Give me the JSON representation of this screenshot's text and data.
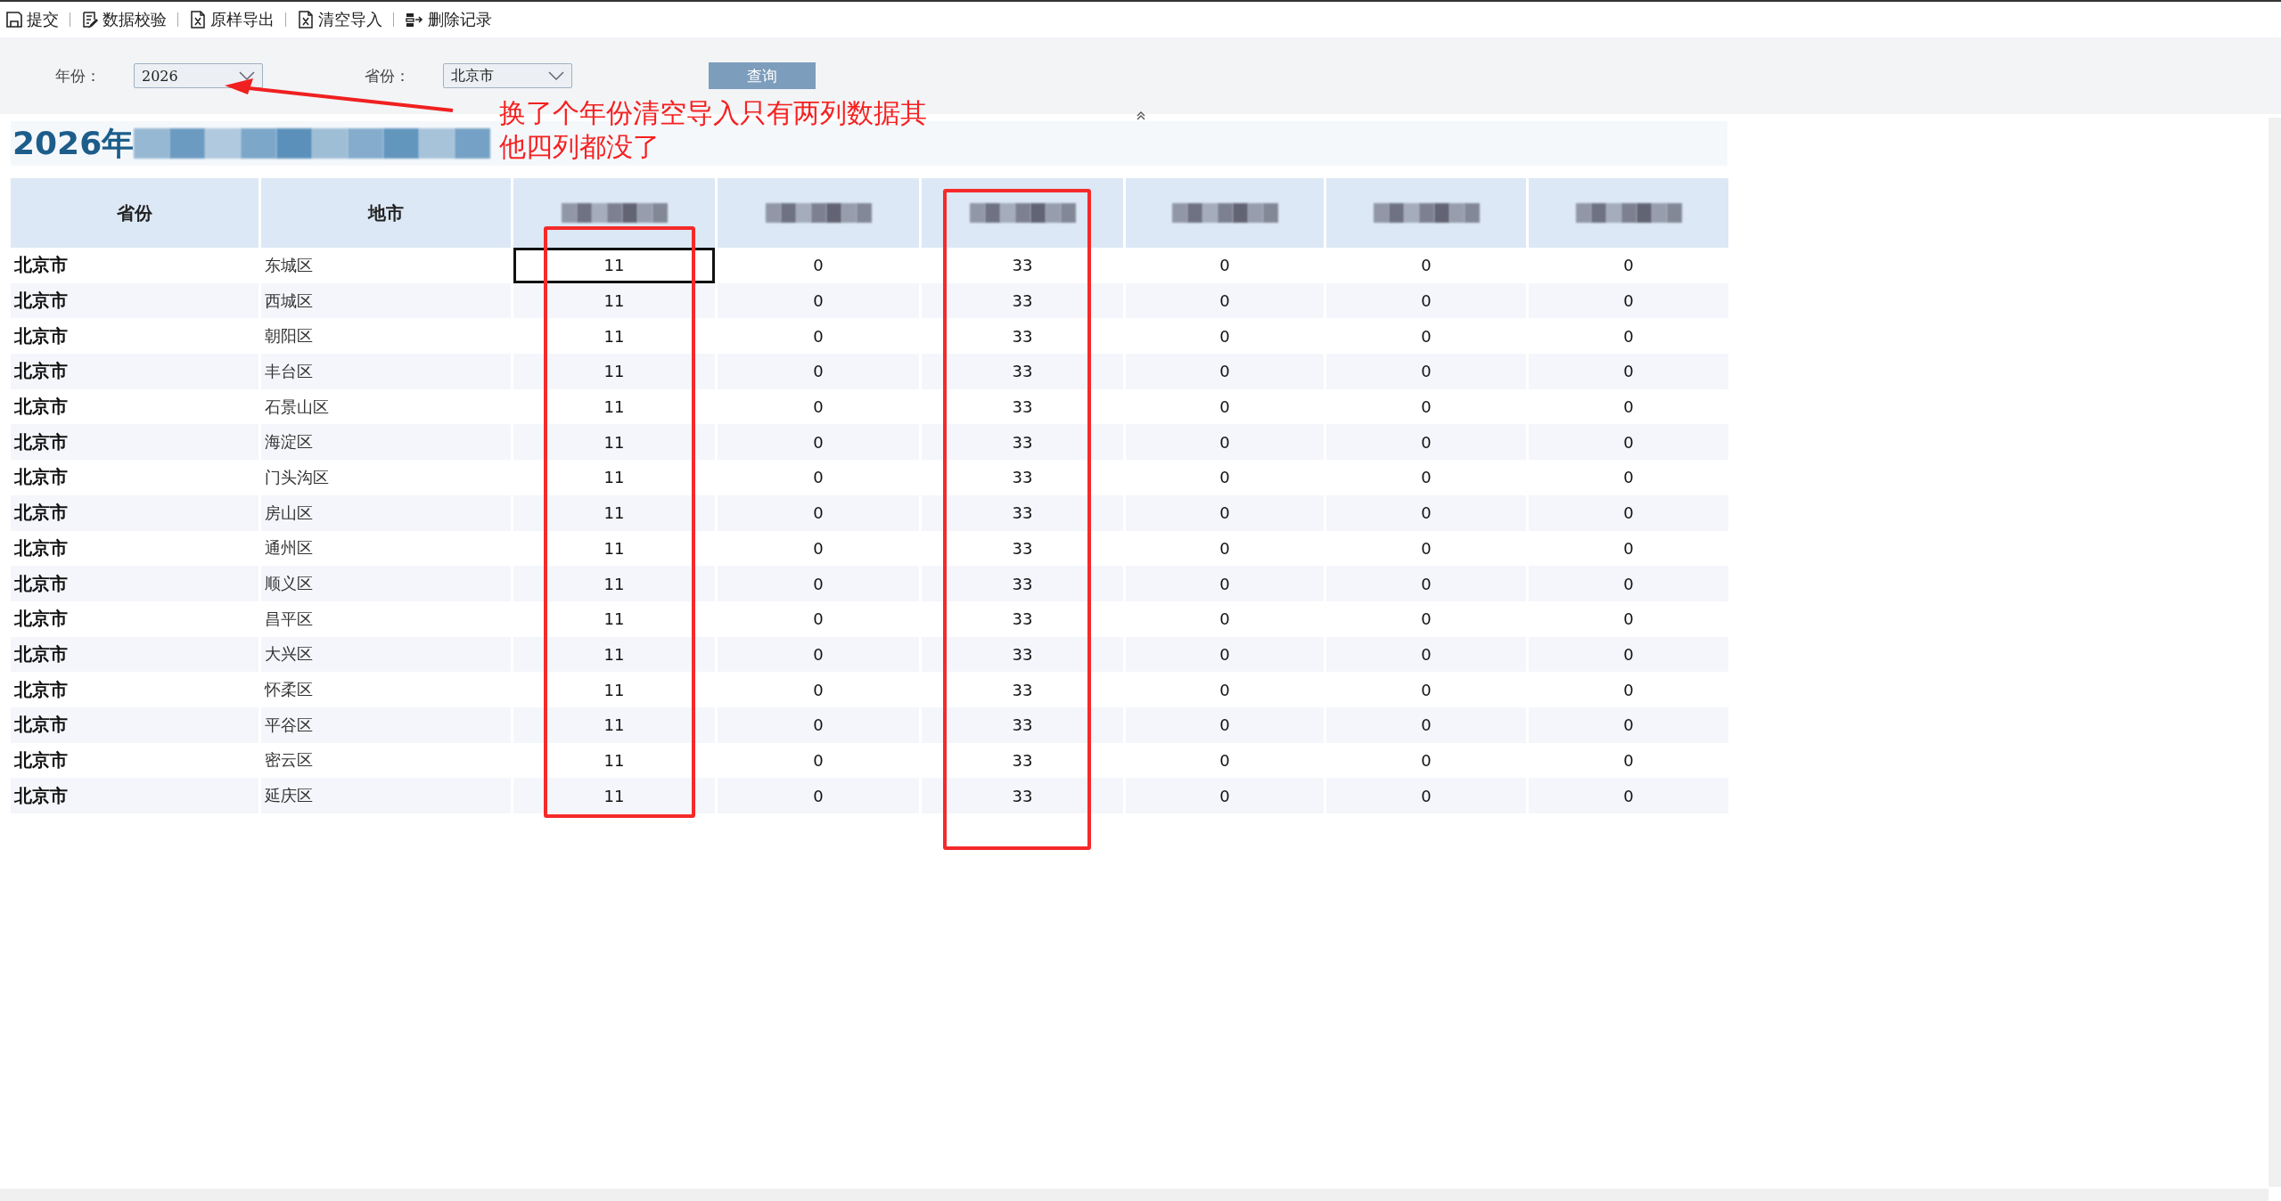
{
  "toolbar": [
    {
      "label": "提交",
      "kind": "save"
    },
    {
      "label": "数据校验",
      "kind": "check"
    },
    {
      "label": "原样导出",
      "kind": "excel"
    },
    {
      "label": "清空导入",
      "kind": "excel"
    },
    {
      "label": "删除记录",
      "kind": "delete"
    }
  ],
  "filters": [
    {
      "label": "年份：",
      "value": "2026"
    },
    {
      "label": "省份：",
      "value": "北京市"
    }
  ],
  "query_button": "查询",
  "report_title": {
    "text": "2026年",
    "redacted": true
  },
  "table": {
    "columns": [
      {
        "label": "省份"
      },
      {
        "label": "地市"
      },
      {
        "kind": "redacted"
      },
      {
        "kind": "redacted"
      },
      {
        "kind": "redacted"
      },
      {
        "kind": "redacted"
      },
      {
        "kind": "redacted"
      },
      {
        "kind": "redacted"
      }
    ],
    "rows": [
      {
        "province": "北京市",
        "city": "东城区",
        "values": [
          {
            "text": "11",
            "selected": true
          },
          {
            "text": "0",
            "selected": false
          },
          {
            "text": "33",
            "selected": false
          },
          {
            "text": "0",
            "selected": false
          },
          {
            "text": "0",
            "selected": false
          },
          {
            "text": "0",
            "selected": false
          }
        ]
      },
      {
        "province": "北京市",
        "city": "西城区",
        "values": [
          {
            "text": "11",
            "selected": false
          },
          {
            "text": "0",
            "selected": false
          },
          {
            "text": "33",
            "selected": false
          },
          {
            "text": "0",
            "selected": false
          },
          {
            "text": "0",
            "selected": false
          },
          {
            "text": "0",
            "selected": false
          }
        ]
      },
      {
        "province": "北京市",
        "city": "朝阳区",
        "values": [
          {
            "text": "11",
            "selected": false
          },
          {
            "text": "0",
            "selected": false
          },
          {
            "text": "33",
            "selected": false
          },
          {
            "text": "0",
            "selected": false
          },
          {
            "text": "0",
            "selected": false
          },
          {
            "text": "0",
            "selected": false
          }
        ]
      },
      {
        "province": "北京市",
        "city": "丰台区",
        "values": [
          {
            "text": "11",
            "selected": false
          },
          {
            "text": "0",
            "selected": false
          },
          {
            "text": "33",
            "selected": false
          },
          {
            "text": "0",
            "selected": false
          },
          {
            "text": "0",
            "selected": false
          },
          {
            "text": "0",
            "selected": false
          }
        ]
      },
      {
        "province": "北京市",
        "city": "石景山区",
        "values": [
          {
            "text": "11",
            "selected": false
          },
          {
            "text": "0",
            "selected": false
          },
          {
            "text": "33",
            "selected": false
          },
          {
            "text": "0",
            "selected": false
          },
          {
            "text": "0",
            "selected": false
          },
          {
            "text": "0",
            "selected": false
          }
        ]
      },
      {
        "province": "北京市",
        "city": "海淀区",
        "values": [
          {
            "text": "11",
            "selected": false
          },
          {
            "text": "0",
            "selected": false
          },
          {
            "text": "33",
            "selected": false
          },
          {
            "text": "0",
            "selected": false
          },
          {
            "text": "0",
            "selected": false
          },
          {
            "text": "0",
            "selected": false
          }
        ]
      },
      {
        "province": "北京市",
        "city": "门头沟区",
        "values": [
          {
            "text": "11",
            "selected": false
          },
          {
            "text": "0",
            "selected": false
          },
          {
            "text": "33",
            "selected": false
          },
          {
            "text": "0",
            "selected": false
          },
          {
            "text": "0",
            "selected": false
          },
          {
            "text": "0",
            "selected": false
          }
        ]
      },
      {
        "province": "北京市",
        "city": "房山区",
        "values": [
          {
            "text": "11",
            "selected": false
          },
          {
            "text": "0",
            "selected": false
          },
          {
            "text": "33",
            "selected": false
          },
          {
            "text": "0",
            "selected": false
          },
          {
            "text": "0",
            "selected": false
          },
          {
            "text": "0",
            "selected": false
          }
        ]
      },
      {
        "province": "北京市",
        "city": "通州区",
        "values": [
          {
            "text": "11",
            "selected": false
          },
          {
            "text": "0",
            "selected": false
          },
          {
            "text": "33",
            "selected": false
          },
          {
            "text": "0",
            "selected": false
          },
          {
            "text": "0",
            "selected": false
          },
          {
            "text": "0",
            "selected": false
          }
        ]
      },
      {
        "province": "北京市",
        "city": "顺义区",
        "values": [
          {
            "text": "11",
            "selected": false
          },
          {
            "text": "0",
            "selected": false
          },
          {
            "text": "33",
            "selected": false
          },
          {
            "text": "0",
            "selected": false
          },
          {
            "text": "0",
            "selected": false
          },
          {
            "text": "0",
            "selected": false
          }
        ]
      },
      {
        "province": "北京市",
        "city": "昌平区",
        "values": [
          {
            "text": "11",
            "selected": false
          },
          {
            "text": "0",
            "selected": false
          },
          {
            "text": "33",
            "selected": false
          },
          {
            "text": "0",
            "selected": false
          },
          {
            "text": "0",
            "selected": false
          },
          {
            "text": "0",
            "selected": false
          }
        ]
      },
      {
        "province": "北京市",
        "city": "大兴区",
        "values": [
          {
            "text": "11",
            "selected": false
          },
          {
            "text": "0",
            "selected": false
          },
          {
            "text": "33",
            "selected": false
          },
          {
            "text": "0",
            "selected": false
          },
          {
            "text": "0",
            "selected": false
          },
          {
            "text": "0",
            "selected": false
          }
        ]
      },
      {
        "province": "北京市",
        "city": "怀柔区",
        "values": [
          {
            "text": "11",
            "selected": false
          },
          {
            "text": "0",
            "selected": false
          },
          {
            "text": "33",
            "selected": false
          },
          {
            "text": "0",
            "selected": false
          },
          {
            "text": "0",
            "selected": false
          },
          {
            "text": "0",
            "selected": false
          }
        ]
      },
      {
        "province": "北京市",
        "city": "平谷区",
        "values": [
          {
            "text": "11",
            "selected": false
          },
          {
            "text": "0",
            "selected": false
          },
          {
            "text": "33",
            "selected": false
          },
          {
            "text": "0",
            "selected": false
          },
          {
            "text": "0",
            "selected": false
          },
          {
            "text": "0",
            "selected": false
          }
        ]
      },
      {
        "province": "北京市",
        "city": "密云区",
        "values": [
          {
            "text": "11",
            "selected": false
          },
          {
            "text": "0",
            "selected": false
          },
          {
            "text": "33",
            "selected": false
          },
          {
            "text": "0",
            "selected": false
          },
          {
            "text": "0",
            "selected": false
          },
          {
            "text": "0",
            "selected": false
          }
        ]
      },
      {
        "province": "北京市",
        "city": "延庆区",
        "values": [
          {
            "text": "11",
            "selected": false
          },
          {
            "text": "0",
            "selected": false
          },
          {
            "text": "33",
            "selected": false
          },
          {
            "text": "0",
            "selected": false
          },
          {
            "text": "0",
            "selected": false
          },
          {
            "text": "0",
            "selected": false
          }
        ]
      }
    ]
  },
  "annotations": [
    {
      "kind": "arrow"
    },
    {
      "kind": "box"
    },
    {
      "kind": "box"
    },
    {
      "kind": "note",
      "text": "换了个年份清空导入只有两列数据其他四列都没了"
    }
  ]
}
